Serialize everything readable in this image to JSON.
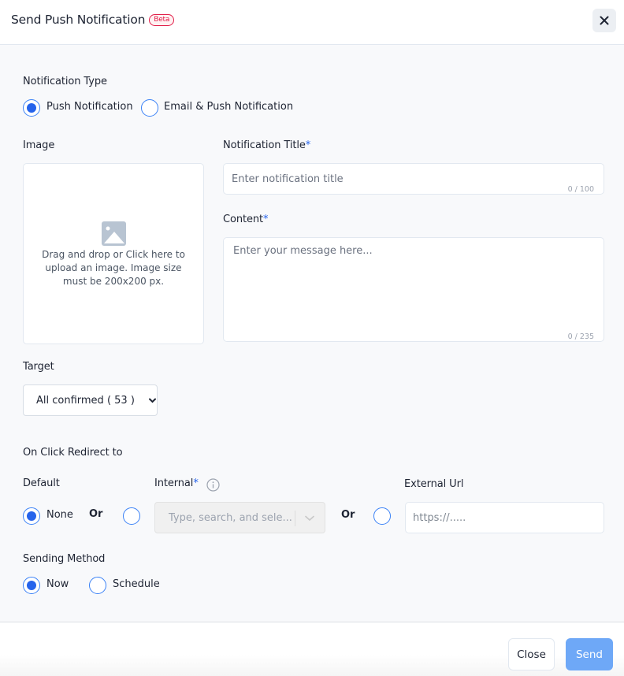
{
  "dialog": {
    "title": "Send Push Notification",
    "badge": "Beta",
    "close_icon": "close-icon"
  },
  "notification_type": {
    "label": "Notification Type",
    "options": [
      {
        "label": "Push Notification",
        "selected": true
      },
      {
        "label": "Email & Push Notification",
        "selected": false
      }
    ]
  },
  "image": {
    "label": "Image",
    "icon": "image-icon",
    "hint": "Drag and drop or Click here to upload an image. Image size must be 200x200 px."
  },
  "title_field": {
    "label": "Notification Title",
    "required_mark": "*",
    "placeholder": "Enter notification title",
    "value": "",
    "counter": "0 / 100"
  },
  "content_field": {
    "label": "Content",
    "required_mark": "*",
    "placeholder": "Enter your message here...",
    "value": "",
    "counter": "0 / 235"
  },
  "target": {
    "label": "Target",
    "selected": "All confirmed ( 53 )"
  },
  "redirect": {
    "label": "On Click Redirect to",
    "default": {
      "label": "Default",
      "option_label": "None",
      "selected": true
    },
    "or_label": "Or",
    "internal": {
      "label": "Internal",
      "required_mark": "*",
      "info_icon": "info-icon",
      "placeholder": "Type, search, and sele...",
      "selected": false
    },
    "external": {
      "label": "External Url",
      "placeholder": "https://.....",
      "value": "",
      "selected": false
    }
  },
  "sending_method": {
    "label": "Sending Method",
    "options": [
      {
        "label": "Now",
        "selected": true
      },
      {
        "label": "Schedule",
        "selected": false
      }
    ]
  },
  "footer": {
    "close_label": "Close",
    "send_label": "Send"
  },
  "colors": {
    "accent": "#2563eb",
    "send_button": "#6ea8f7",
    "badge": "#e11d48"
  }
}
